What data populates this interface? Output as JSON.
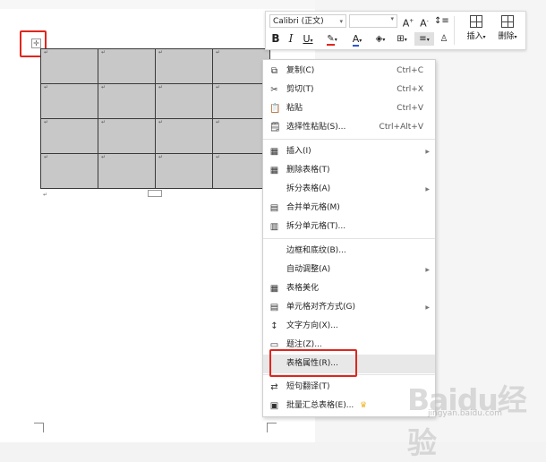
{
  "toolbar": {
    "font_name": "Calibri (正文)",
    "font_size": "",
    "insert_label": "插入",
    "delete_label": "删除"
  },
  "table": {
    "rows": 4,
    "cols": 4,
    "cell_mark": "↵"
  },
  "context_menu": {
    "items": [
      {
        "key": "copy",
        "icon": "copy-icon",
        "glyph": "⧉",
        "label": "复制(C)",
        "shortcut": "Ctrl+C",
        "arrow": false
      },
      {
        "key": "cut",
        "icon": "scissors-icon",
        "glyph": "✂",
        "label": "剪切(T)",
        "shortcut": "Ctrl+X",
        "arrow": false
      },
      {
        "key": "paste",
        "icon": "clipboard-icon",
        "glyph": "📋",
        "label": "粘贴",
        "shortcut": "Ctrl+V",
        "arrow": false
      },
      {
        "key": "paste-special",
        "icon": "paste-special-icon",
        "glyph": "🗒",
        "label": "选择性粘贴(S)...",
        "shortcut": "Ctrl+Alt+V",
        "arrow": false
      },
      {
        "key": "insert",
        "icon": "table-insert-icon",
        "glyph": "▦",
        "label": "插入(I)",
        "shortcut": "",
        "arrow": true
      },
      {
        "key": "delete-table",
        "icon": "table-delete-icon",
        "glyph": "▦",
        "label": "删除表格(T)",
        "shortcut": "",
        "arrow": false
      },
      {
        "key": "split-table",
        "icon": "",
        "glyph": "",
        "label": "拆分表格(A)",
        "shortcut": "",
        "arrow": true
      },
      {
        "key": "merge-cells",
        "icon": "merge-cells-icon",
        "glyph": "▤",
        "label": "合并单元格(M)",
        "shortcut": "",
        "arrow": false
      },
      {
        "key": "split-cells",
        "icon": "split-cells-icon",
        "glyph": "▥",
        "label": "拆分单元格(T)...",
        "shortcut": "",
        "arrow": false
      },
      {
        "key": "borders",
        "icon": "",
        "glyph": "",
        "label": "边框和底纹(B)...",
        "shortcut": "",
        "arrow": false
      },
      {
        "key": "autofit",
        "icon": "",
        "glyph": "",
        "label": "自动调整(A)",
        "shortcut": "",
        "arrow": true
      },
      {
        "key": "beautify",
        "icon": "table-beautify-icon",
        "glyph": "▦",
        "label": "表格美化",
        "shortcut": "",
        "arrow": false
      },
      {
        "key": "cell-align",
        "icon": "cell-align-icon",
        "glyph": "▤",
        "label": "单元格对齐方式(G)",
        "shortcut": "",
        "arrow": true
      },
      {
        "key": "text-direction",
        "icon": "text-direction-icon",
        "glyph": "↕",
        "label": "文字方向(X)...",
        "shortcut": "",
        "arrow": false
      },
      {
        "key": "caption",
        "icon": "caption-icon",
        "glyph": "▭",
        "label": "题注(Z)...",
        "shortcut": "",
        "arrow": false
      },
      {
        "key": "table-properties",
        "icon": "",
        "glyph": "",
        "label": "表格属性(R)...",
        "shortcut": "",
        "arrow": false
      },
      {
        "key": "translate",
        "icon": "translate-icon",
        "glyph": "⇄",
        "label": "短句翻译(T)",
        "shortcut": "",
        "arrow": false
      },
      {
        "key": "batch-summary",
        "icon": "batch-summary-icon",
        "glyph": "▣",
        "label": "批量汇总表格(E)...",
        "shortcut": "",
        "arrow": false,
        "crown": "♛"
      }
    ]
  },
  "watermark": {
    "main": "Baidu经验",
    "sub": "jingyan.baidu.com"
  },
  "colors": {
    "highlight_box": "#e0261d",
    "font_color": "#2b56d8",
    "highlight": "#e0261d",
    "cell_fill": "#c8c8c8"
  }
}
